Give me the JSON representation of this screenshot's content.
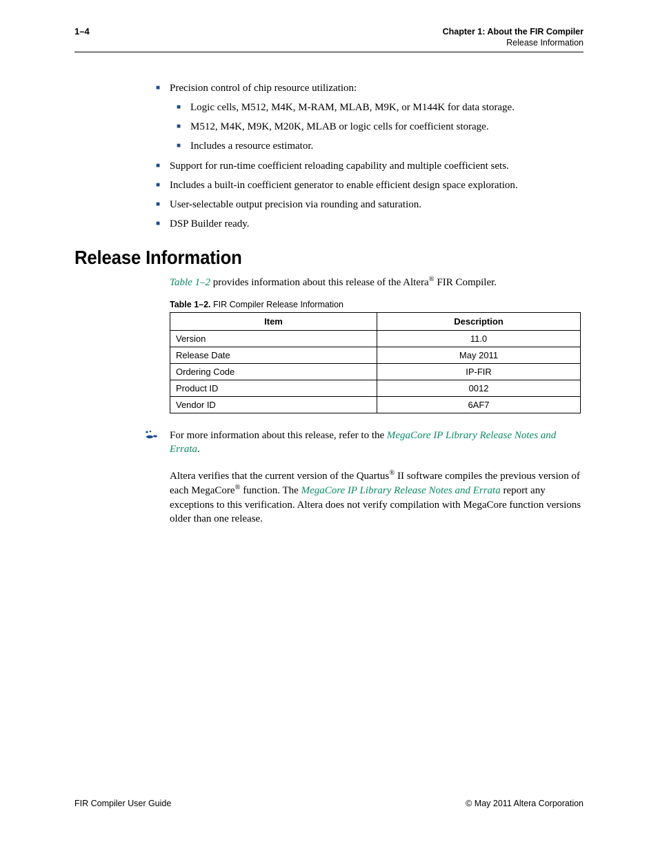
{
  "header": {
    "page_num": "1–4",
    "chapter": "Chapter 1: About the FIR Compiler",
    "section": "Release Information"
  },
  "bullets": {
    "b1": "Precision control of chip resource utilization:",
    "b1a": "Logic cells, M512, M4K, M-RAM, MLAB, M9K, or M144K for data storage.",
    "b1b": "M512, M4K, M9K, M20K, MLAB or logic cells for coefficient storage.",
    "b1c": "Includes a resource estimator.",
    "b2": "Support for run-time coefficient reloading capability and multiple coefficient sets.",
    "b3": "Includes a built-in coefficient generator to enable efficient design space exploration.",
    "b4": "User-selectable output precision via rounding and saturation.",
    "b5": "DSP Builder ready."
  },
  "section_title": "Release Information",
  "intro": {
    "ref": "Table 1–2",
    "rest": " provides information about this release of the Altera",
    "reg": "®",
    "tail": " FIR Compiler."
  },
  "table": {
    "caption_num": "Table 1–2.",
    "caption_text": "FIR Compiler Release Information",
    "headers": {
      "item": "Item",
      "desc": "Description"
    },
    "rows": [
      {
        "item": "Version",
        "desc": "11.0"
      },
      {
        "item": "Release Date",
        "desc": "May 2011"
      },
      {
        "item": "Ordering Code",
        "desc": "IP-FIR"
      },
      {
        "item": "Product ID",
        "desc": "0012"
      },
      {
        "item": "Vendor ID",
        "desc": "6AF7"
      }
    ]
  },
  "note": {
    "pre": "For more information about this release, refer to the ",
    "link": "MegaCore IP Library Release Notes and Errata",
    "post": "."
  },
  "para": {
    "p1a": "Altera verifies that the current version of the Quartus",
    "reg1": "®",
    "p1b": " II software compiles the previous version of each MegaCore",
    "reg2": "®",
    "p1c": " function. The ",
    "link": "MegaCore IP Library Release Notes and Errata",
    "p1d": " report any exceptions to this verification. Altera does not verify compilation with MegaCore function versions older than one release."
  },
  "footer": {
    "left": "FIR Compiler User Guide",
    "right": "© May 2011   Altera Corporation"
  }
}
